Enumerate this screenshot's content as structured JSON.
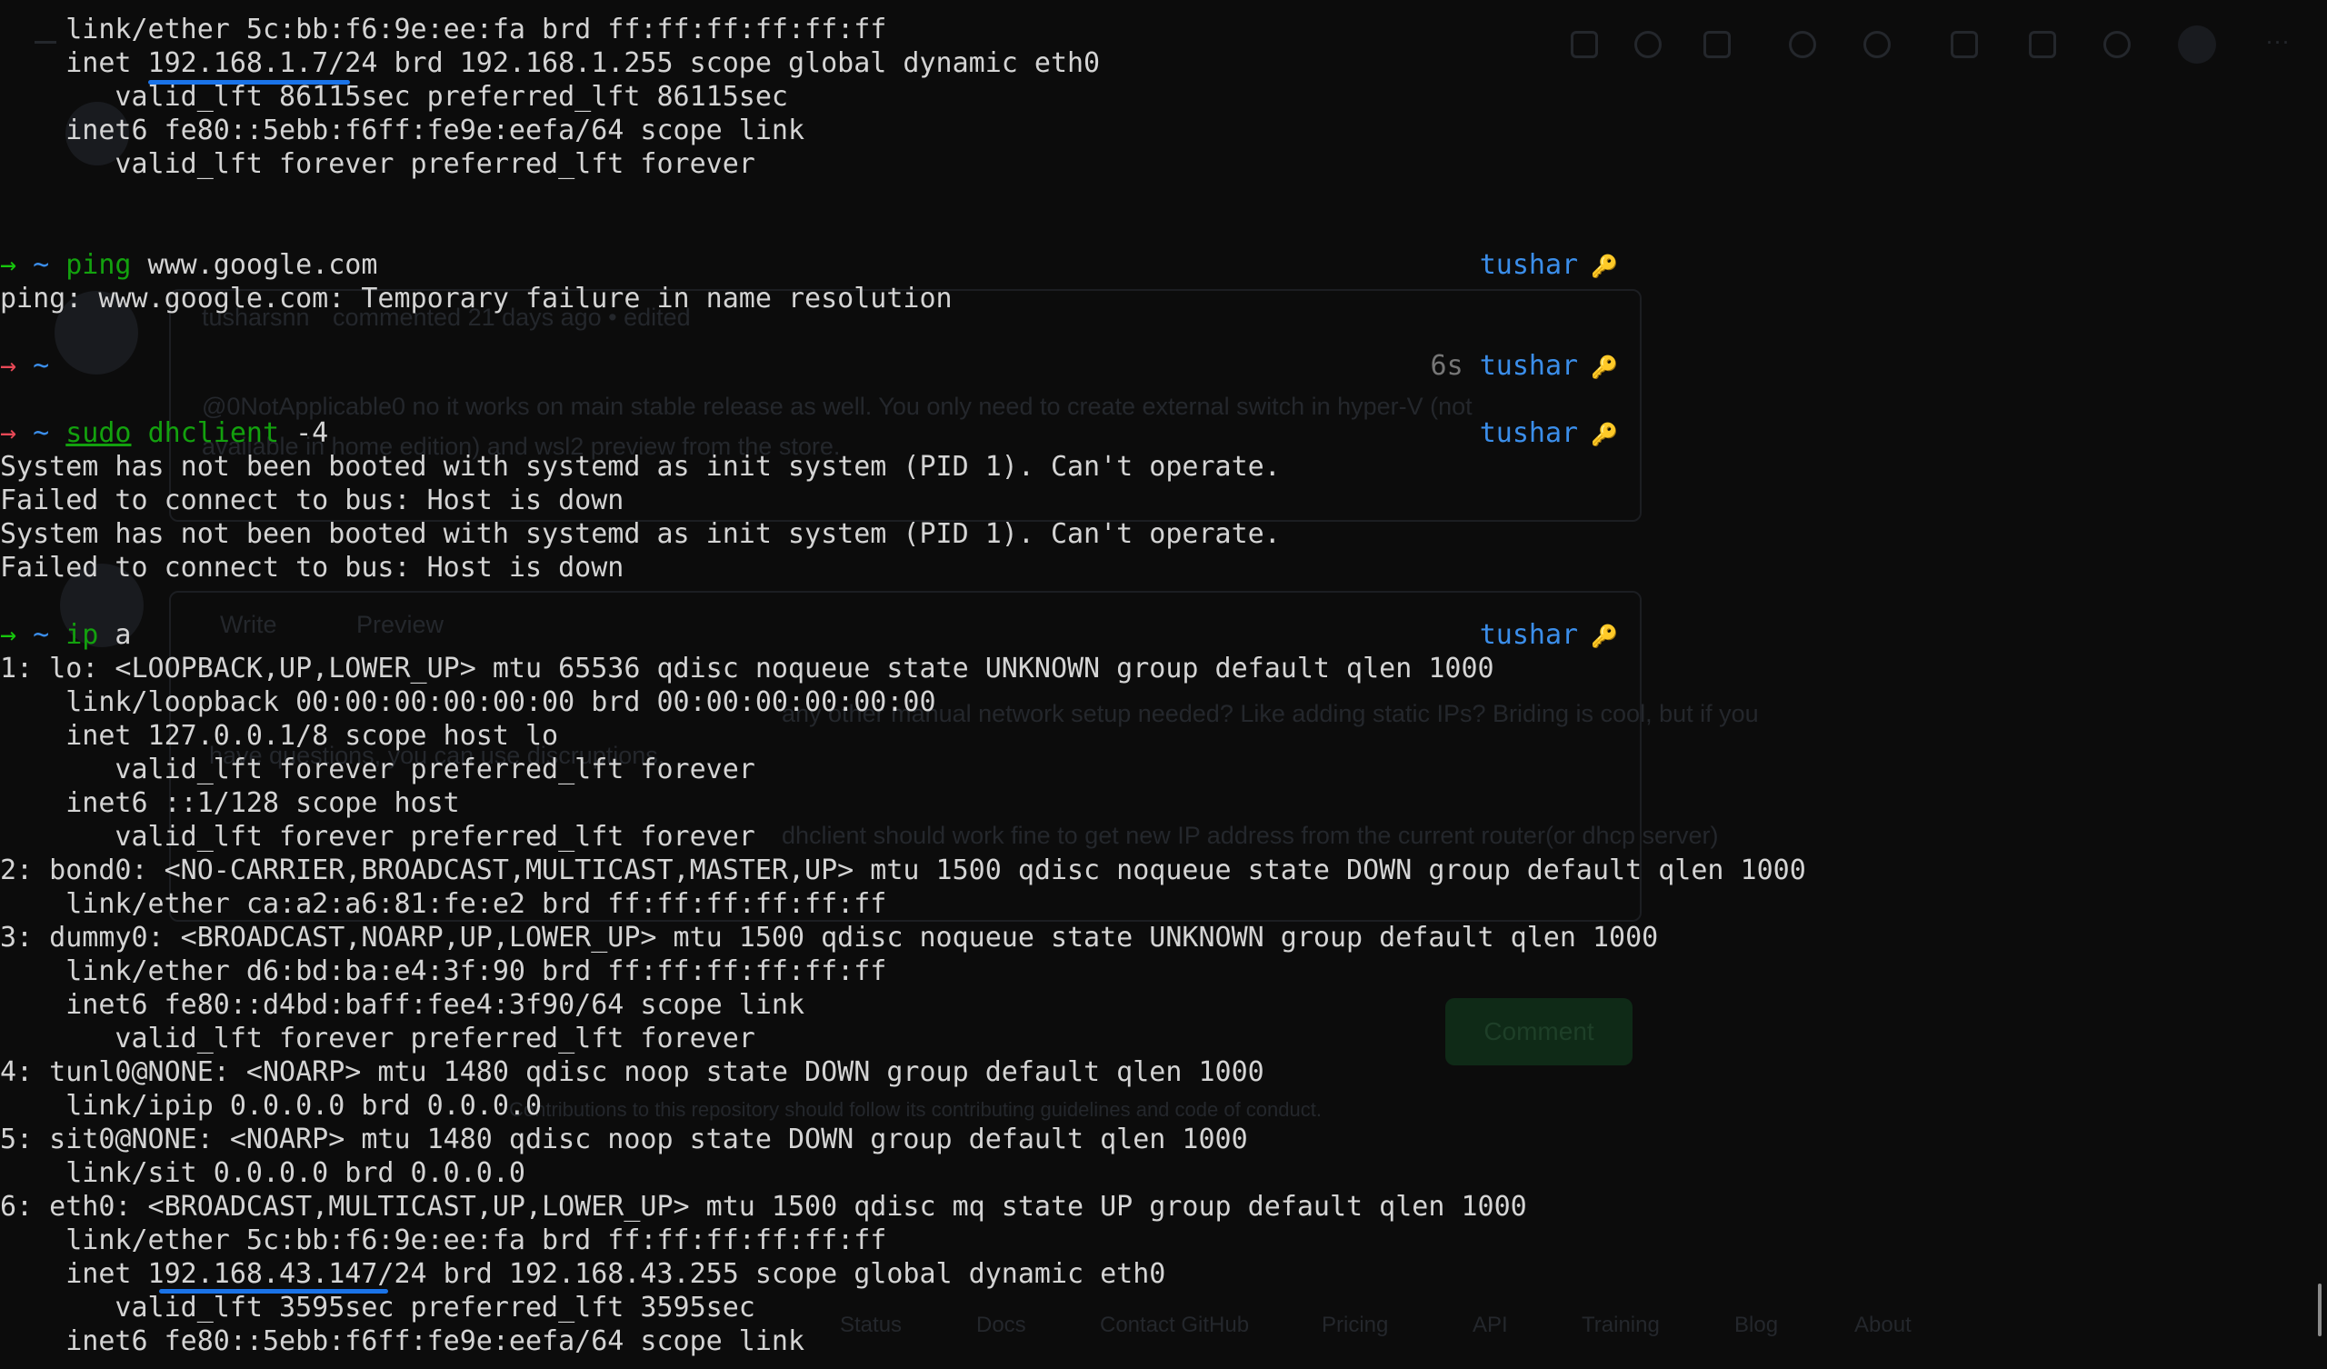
{
  "terminal": {
    "lines": [
      "    link/ether 5c:bb:f6:9e:ee:fa brd ff:ff:ff:ff:ff:ff",
      "    inet 192.168.1.7/24 brd 192.168.1.255 scope global dynamic eth0",
      "       valid_lft 86115sec preferred_lft 86115sec",
      "    inet6 fe80::5ebb:f6ff:fe9e:eefa/64 scope link",
      "       valid_lft forever preferred_lft forever"
    ],
    "prompt": {
      "arrow": "→",
      "dir": "~",
      "user": "tushar",
      "key_icon": "key-icon"
    },
    "block1": {
      "command": "ping",
      "args": " www.google.com",
      "output": [
        "ping: www.google.com: Temporary failure in name resolution"
      ]
    },
    "block2": {
      "duration": "6s"
    },
    "block3": {
      "command": "sudo",
      "command2": "dhclient",
      "args": " -4",
      "output": [
        "System has not been booted with systemd as init system (PID 1). Can't operate.",
        "Failed to connect to bus: Host is down",
        "System has not been booted with systemd as init system (PID 1). Can't operate.",
        "Failed to connect to bus: Host is down"
      ]
    },
    "block4": {
      "command": "ip",
      "args": " a",
      "output": [
        "1: lo: <LOOPBACK,UP,LOWER_UP> mtu 65536 qdisc noqueue state UNKNOWN group default qlen 1000",
        "    link/loopback 00:00:00:00:00:00 brd 00:00:00:00:00:00",
        "    inet 127.0.0.1/8 scope host lo",
        "       valid_lft forever preferred_lft forever",
        "    inet6 ::1/128 scope host",
        "       valid_lft forever preferred_lft forever",
        "2: bond0: <NO-CARRIER,BROADCAST,MULTICAST,MASTER,UP> mtu 1500 qdisc noqueue state DOWN group default qlen 1000",
        "    link/ether ca:a2:a6:81:fe:e2 brd ff:ff:ff:ff:ff:ff",
        "3: dummy0: <BROADCAST,NOARP,UP,LOWER_UP> mtu 1500 qdisc noqueue state UNKNOWN group default qlen 1000",
        "    link/ether d6:bd:ba:e4:3f:90 brd ff:ff:ff:ff:ff:ff",
        "    inet6 fe80::d4bd:baff:fee4:3f90/64 scope link",
        "       valid_lft forever preferred_lft forever",
        "4: tunl0@NONE: <NOARP> mtu 1480 qdisc noop state DOWN group default qlen 1000",
        "    link/ipip 0.0.0.0 brd 0.0.0.0",
        "5: sit0@NONE: <NOARP> mtu 1480 qdisc noop state DOWN group default qlen 1000",
        "    link/sit 0.0.0.0 brd 0.0.0.0",
        "6: eth0: <BROADCAST,MULTICAST,UP,LOWER_UP> mtu 1500 qdisc mq state UP group default qlen 1000",
        "    link/ether 5c:bb:f6:9e:ee:fa brd ff:ff:ff:ff:ff:ff",
        "    inet 192.168.43.147/24 brd 192.168.43.255 scope global dynamic eth0",
        "       valid_lft 3595sec preferred_lft 3595sec",
        "    inet6 fe80::5ebb:f6ff:fe9e:eefa/64 scope link"
      ]
    }
  },
  "background_page": {
    "comment_author": "tusharsnn",
    "comment_meta": "commented 21 days ago • edited",
    "mention_text": "@0NotApplicable0 no it works on main stable release as well. You only need to create external switch in hyper-V (not",
    "mention_text2": "available in home edition) and wsl2 preview from the store.",
    "tab_write": "Write",
    "tab_preview": "Preview",
    "reply_text1": "any other manual network setup needed? Like adding static IPs? Briding is cool, but if you",
    "reply_text2": "have questions, you can use discruptions.",
    "reply_text3": "dhclient should work fine to get new IP address from the current router(or dhcp server)",
    "comment_button": "Comment",
    "footer_note": "Contributions to this repository should follow its contributing guidelines and code of conduct.",
    "footer_links": [
      "Status",
      "Docs",
      "Contact GitHub",
      "Pricing",
      "API",
      "Training",
      "Blog",
      "About"
    ]
  }
}
